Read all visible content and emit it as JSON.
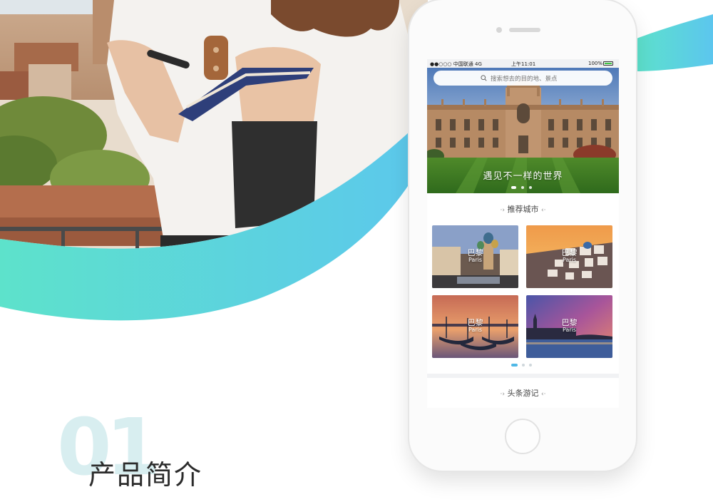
{
  "colors": {
    "wave_start": "#5de2cb",
    "wave_end": "#5cc6ee",
    "accent_blue": "#4fb8e6",
    "intro_number": "#d8eef0"
  },
  "hero_photo": {
    "icon": "woman-with-camera-photo"
  },
  "status_bar": {
    "carrier": "●●○○○ 中国联通  4G",
    "time": "上午11:01",
    "battery": "100%"
  },
  "search": {
    "placeholder": "搜索想去的目的地、景点",
    "icon": "search-icon"
  },
  "banner": {
    "slogan": "遇见不一样的世界",
    "slides": 3,
    "active_slide": 1
  },
  "recommended": {
    "title": "推荐城市",
    "left_deco": "·›",
    "right_deco": "‹·",
    "cities": [
      {
        "name": "巴黎",
        "sub": "Paris"
      },
      {
        "name": "巴黎",
        "sub": "Paris"
      },
      {
        "name": "巴黎",
        "sub": "Paris"
      },
      {
        "name": "巴黎",
        "sub": "Paris"
      }
    ],
    "pages": 3,
    "active_page": 1
  },
  "travel_notes": {
    "title": "头条游记",
    "left_deco": "·›",
    "right_deco": "‹·"
  },
  "intro": {
    "number": "01",
    "title": "产品简介"
  }
}
